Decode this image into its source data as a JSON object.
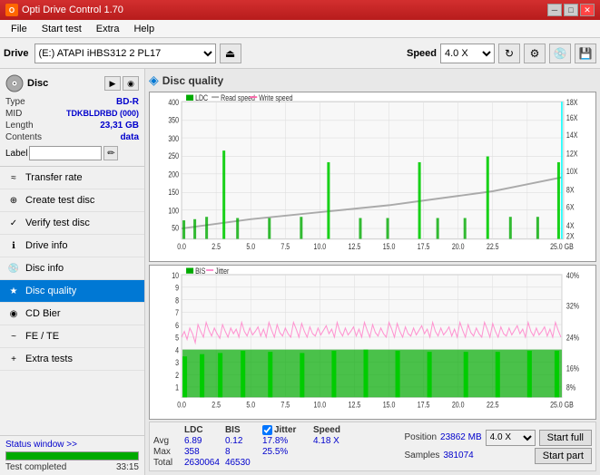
{
  "titlebar": {
    "title": "Opti Drive Control 1.70",
    "icon": "O",
    "minimize_label": "─",
    "maximize_label": "□",
    "close_label": "✕"
  },
  "menubar": {
    "items": [
      "File",
      "Start test",
      "Extra",
      "Help"
    ]
  },
  "toolbar": {
    "drive_label": "Drive",
    "drive_value": "(E:)  ATAPI iHBS312  2 PL17",
    "speed_label": "Speed",
    "speed_value": "4.0 X"
  },
  "disc": {
    "type_label": "Type",
    "type_value": "BD-R",
    "mid_label": "MID",
    "mid_value": "TDKBLDRBD (000)",
    "length_label": "Length",
    "length_value": "23,31 GB",
    "contents_label": "Contents",
    "contents_value": "data",
    "label_label": "Label"
  },
  "sidebar_items": [
    {
      "id": "transfer-rate",
      "label": "Transfer rate",
      "icon": "≈"
    },
    {
      "id": "create-test-disc",
      "label": "Create test disc",
      "icon": "+"
    },
    {
      "id": "verify-test-disc",
      "label": "Verify test disc",
      "icon": "✓"
    },
    {
      "id": "drive-info",
      "label": "Drive info",
      "icon": "i"
    },
    {
      "id": "disc-info",
      "label": "Disc info",
      "icon": "📀"
    },
    {
      "id": "disc-quality",
      "label": "Disc quality",
      "icon": "★",
      "active": true
    },
    {
      "id": "cd-bier",
      "label": "CD Bier",
      "icon": "◉"
    },
    {
      "id": "fe-te",
      "label": "FE / TE",
      "icon": "~"
    },
    {
      "id": "extra-tests",
      "label": "Extra tests",
      "icon": "+"
    }
  ],
  "content": {
    "title": "Disc quality"
  },
  "chart_top": {
    "legend": [
      "LDC",
      "Read speed",
      "Write speed"
    ],
    "y_max": 400,
    "y_labels_left": [
      "400",
      "350",
      "300",
      "250",
      "200",
      "150",
      "100",
      "50"
    ],
    "y_labels_right": [
      "18X",
      "16X",
      "14X",
      "12X",
      "10X",
      "8X",
      "6X",
      "4X",
      "2X"
    ],
    "x_labels": [
      "0.0",
      "2.5",
      "5.0",
      "7.5",
      "10.0",
      "12.5",
      "15.0",
      "17.5",
      "20.0",
      "22.5",
      "25.0"
    ]
  },
  "chart_bottom": {
    "legend": [
      "BIS",
      "Jitter"
    ],
    "y_max": 10,
    "y_labels_left": [
      "10",
      "9",
      "8",
      "7",
      "6",
      "5",
      "4",
      "3",
      "2",
      "1"
    ],
    "y_labels_right": [
      "40%",
      "32%",
      "24%",
      "16%",
      "8%"
    ],
    "x_labels": [
      "0.0",
      "2.5",
      "5.0",
      "7.5",
      "10.0",
      "12.5",
      "15.0",
      "17.5",
      "20.0",
      "22.5",
      "25.0"
    ]
  },
  "stats": {
    "ldc_label": "LDC",
    "bis_label": "BIS",
    "jitter_label": "Jitter",
    "speed_label": "Speed",
    "avg_label": "Avg",
    "max_label": "Max",
    "total_label": "Total",
    "avg_ldc": "6.89",
    "avg_bis": "0.12",
    "avg_jitter": "17.8%",
    "avg_speed": "4.18 X",
    "max_ldc": "358",
    "max_bis": "8",
    "max_jitter": "25.5%",
    "total_ldc": "2630064",
    "total_bis": "46530",
    "position_label": "Position",
    "position_value": "23862 MB",
    "samples_label": "Samples",
    "samples_value": "381074",
    "speed_select": "4.0 X",
    "start_full_label": "Start full",
    "start_part_label": "Start part"
  },
  "status": {
    "window_label": "Status window >>",
    "progress": 100,
    "completed_label": "Test completed",
    "time_label": "33:15"
  }
}
